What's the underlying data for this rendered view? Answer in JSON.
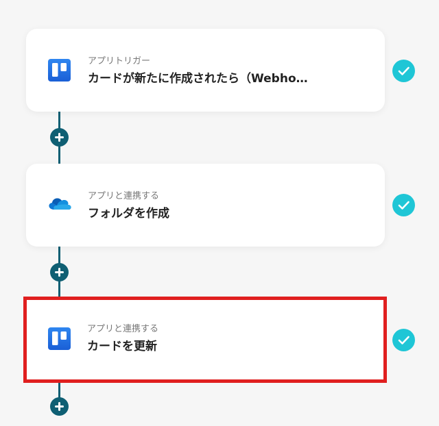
{
  "flow": {
    "steps": [
      {
        "icon": "trello-icon",
        "subtitle": "アプリトリガー",
        "title": "カードが新たに作成されたら（Webho…",
        "status": "completed"
      },
      {
        "icon": "onedrive-icon",
        "subtitle": "アプリと連携する",
        "title": "フォルダを作成",
        "status": "completed"
      },
      {
        "icon": "trello-icon",
        "subtitle": "アプリと連携する",
        "title": "カードを更新",
        "status": "completed",
        "highlighted": true
      }
    ],
    "add_step_icon": "plus-icon"
  },
  "colors": {
    "connector": "#0f5f73",
    "check": "#1fc6d6",
    "highlight_border": "#e01f1f",
    "trello_blue": "#1f6fe5",
    "onedrive_blue": "#0f78d4"
  }
}
